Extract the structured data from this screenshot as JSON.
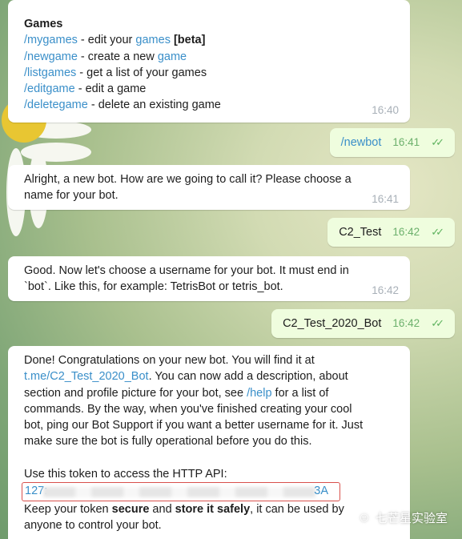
{
  "messages": {
    "games": {
      "title": "Games",
      "lines": [
        {
          "cmd": "/mygames",
          "sep": " - edit your ",
          "link": "games",
          "tail": " [beta]"
        },
        {
          "cmd": "/newgame",
          "sep": " - create a new ",
          "link": "game"
        },
        {
          "cmd": "/listgames",
          "sep": " - get a list of your games"
        },
        {
          "cmd": "/editgame",
          "sep": " - edit a game"
        },
        {
          "cmd": "/deletegame",
          "sep": " - delete an existing game"
        }
      ],
      "time": "16:40"
    },
    "newbot": {
      "text": "/newbot",
      "time": "16:41"
    },
    "alright": {
      "line1": "Alright, a new bot. How are we going to call it? Please choose a",
      "line2": "name for your bot.",
      "time": "16:41"
    },
    "c2test": {
      "text": "C2_Test",
      "time": "16:42"
    },
    "good": {
      "line1": "Good. Now let's choose a username for your bot. It must end in",
      "line2": "`bot`. Like this, for example: TetrisBot or tetris_bot.",
      "time": "16:42"
    },
    "c2test2020": {
      "text": "C2_Test_2020_Bot",
      "time": "16:42"
    },
    "done": {
      "l1": "Done! Congratulations on your new bot. You will find it at",
      "link1": "t.me/C2_Test_2020_Bot",
      "l2": ". You can now add a description, about",
      "l3a": "section and profile picture for your bot, see ",
      "link2": "/help",
      "l3b": " for a list of",
      "l4": "commands. By the way, when you've finished creating your cool",
      "l5": "bot, ping our Bot Support if you want a better username for it. Just",
      "l6": "make sure the bot is fully operational before you do this.",
      "l7": "Use this token to access the HTTP API:",
      "token_start": "127:",
      "token_end": "3A",
      "k1": "Keep your token ",
      "k2": "secure",
      "k3": " and ",
      "k4": "store it safely",
      "k5": ", it can be used by",
      "l9": "anyone to control your bot."
    }
  },
  "watermark": "七芒星实验室"
}
